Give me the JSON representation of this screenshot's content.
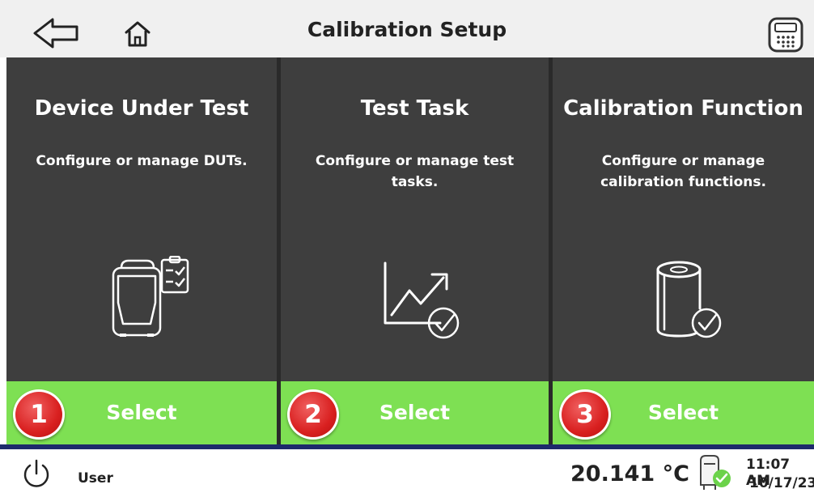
{
  "header": {
    "title": "Calibration Setup",
    "back_icon": "back-arrow-icon",
    "home_icon": "home-icon",
    "calculator_icon": "calculator-icon"
  },
  "panels": [
    {
      "title": "Device Under Test",
      "description": "Configure or manage DUTs.",
      "icon": "dut-clipboard-icon",
      "select_label": "Select",
      "badge": "1"
    },
    {
      "title": "Test Task",
      "description": "Configure or manage test tasks.",
      "icon": "trend-chart-check-icon",
      "select_label": "Select",
      "badge": "2"
    },
    {
      "title": "Calibration Function",
      "description": "Configure or manage calibration functions.",
      "icon": "cylinder-check-icon",
      "select_label": "Select",
      "badge": "3"
    }
  ],
  "footer": {
    "power_icon": "power-icon",
    "user_label": "User",
    "temperature": "20.141 °C",
    "probe_icon": "probe-status-icon",
    "time": "11:07 AM",
    "date": "10/17/23"
  },
  "colors": {
    "panel_bg": "#3e3e3e",
    "select_green": "#7ee053",
    "badge_red": "#d92020",
    "header_bg": "#f0f0f0",
    "accent_navy": "#1d2a6b"
  }
}
